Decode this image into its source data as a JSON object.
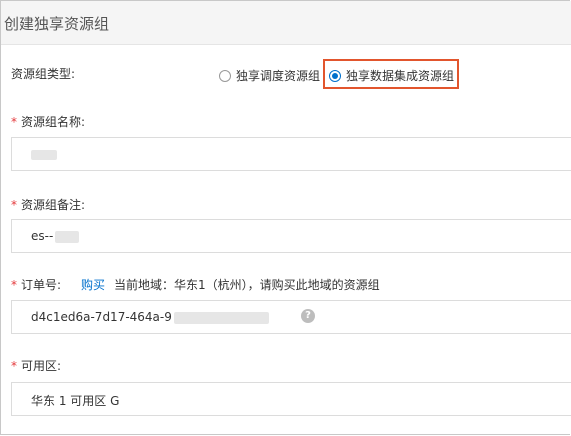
{
  "dialog": {
    "title": "创建独享资源组"
  },
  "resource_group_type": {
    "label": "资源组类型:",
    "options": [
      {
        "label": "独享调度资源组",
        "selected": false
      },
      {
        "label": "独享数据集成资源组",
        "selected": true
      }
    ]
  },
  "resource_group_name": {
    "label": "资源组名称:"
  },
  "resource_group_note": {
    "label": "资源组备注:",
    "value": "es--"
  },
  "order_number": {
    "label": "订单号:",
    "buy_link": "购买",
    "region_info": "当前地域：华东1（杭州），请购买此地域的资源组",
    "value": "d4c1ed6a-7d17-464a-9",
    "help_icon": "?"
  },
  "availability_zone": {
    "label": "可用区:",
    "value": "华东 1 可用区 G"
  },
  "colors": {
    "accent": "#0070cc",
    "highlight": "#e2552d",
    "required": "#e4393c"
  }
}
